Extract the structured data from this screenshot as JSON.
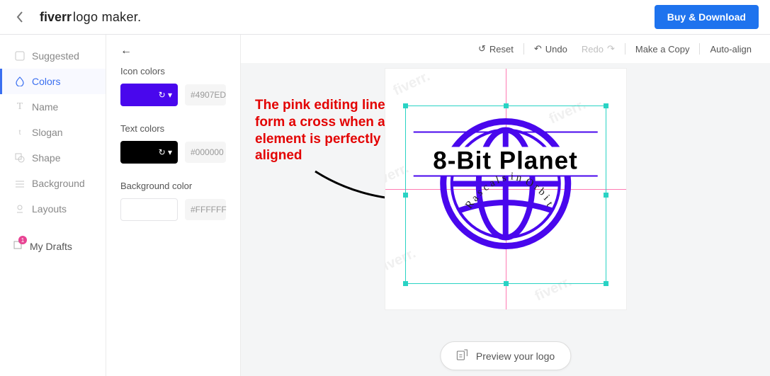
{
  "header": {
    "brand_bold": "fiverr",
    "brand_thin": "logo maker.",
    "buy_label": "Buy & Download"
  },
  "sidenav": {
    "items": [
      {
        "label": "Suggested",
        "icon": "suggested-icon"
      },
      {
        "label": "Colors",
        "icon": "colors-icon"
      },
      {
        "label": "Name",
        "icon": "name-icon"
      },
      {
        "label": "Slogan",
        "icon": "slogan-icon"
      },
      {
        "label": "Shape",
        "icon": "shape-icon"
      },
      {
        "label": "Background",
        "icon": "background-icon"
      },
      {
        "label": "Layouts",
        "icon": "layouts-icon"
      }
    ],
    "drafts_label": "My Drafts",
    "drafts_badge": "1"
  },
  "panel": {
    "icon_colors_label": "Icon colors",
    "icon_color_hex": "#4907ED",
    "text_colors_label": "Text colors",
    "text_color_hex": "#000000",
    "bg_color_label": "Background color",
    "bg_color_hex": "#FFFFFF"
  },
  "toolbar": {
    "reset": "Reset",
    "undo": "Undo",
    "redo": "Redo",
    "copy": "Make a Copy",
    "align": "Auto-align"
  },
  "logo": {
    "brand": "8-Bit Planet",
    "tagline": "Rascals in Orbit",
    "icon_color": "#4907ED",
    "text_color": "#000000",
    "bg_color": "#FFFFFF"
  },
  "annotation": {
    "text": "The pink editing lines form a cross when an element is perfectly aligned"
  },
  "preview": {
    "label": "Preview your logo"
  },
  "watermark": "fiverr."
}
